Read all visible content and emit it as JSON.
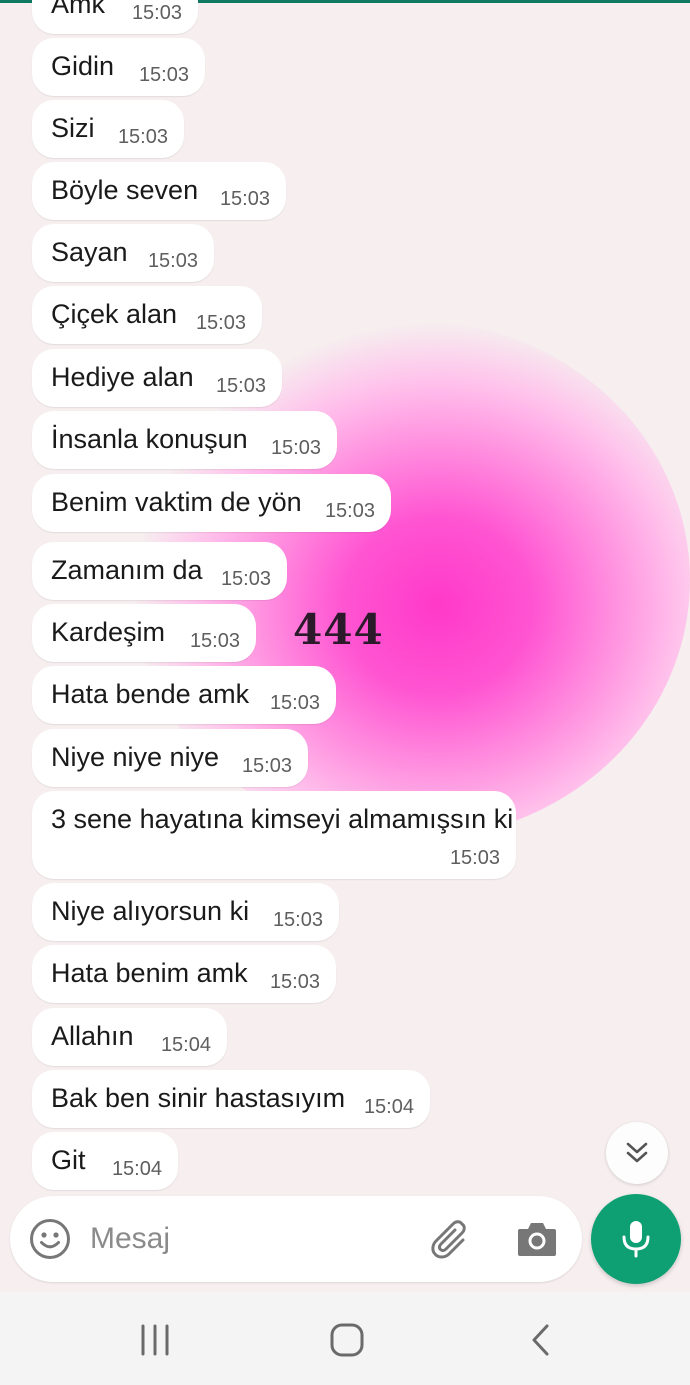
{
  "chat": {
    "messages": [
      {
        "text": "Amk",
        "time": "15:03"
      },
      {
        "text": "Gidin",
        "time": "15:03"
      },
      {
        "text": "Sizi",
        "time": "15:03"
      },
      {
        "text": "Böyle seven",
        "time": "15:03"
      },
      {
        "text": "Sayan",
        "time": "15:03"
      },
      {
        "text": "Çiçek alan",
        "time": "15:03"
      },
      {
        "text": "Hediye alan",
        "time": "15:03"
      },
      {
        "text": "İnsanla konuşun",
        "time": "15:03"
      },
      {
        "text": "Benim vaktim de yön",
        "time": "15:03"
      },
      {
        "text": "Zamanım da",
        "time": "15:03"
      },
      {
        "text": "Kardeşim",
        "time": "15:03"
      },
      {
        "text": "Hata bende amk",
        "time": "15:03"
      },
      {
        "text": "Niye niye niye",
        "time": "15:03"
      },
      {
        "text": "3 sene hayatına kimseyi almamışsın ki",
        "time": "15:03"
      },
      {
        "text": "Niye alıyorsun ki",
        "time": "15:03"
      },
      {
        "text": "Hata benim amk",
        "time": "15:03"
      },
      {
        "text": "Allahın",
        "time": "15:04"
      },
      {
        "text": "Bak ben sinir hastasıyım",
        "time": "15:04"
      },
      {
        "text": "Git",
        "time": "15:04"
      }
    ],
    "wallpaper_text": "444"
  },
  "composer": {
    "placeholder": "Mesaj",
    "emoji_icon": "emoji-icon",
    "attach_icon": "paperclip-icon",
    "camera_icon": "camera-icon",
    "mic_icon": "microphone-icon"
  },
  "scroll_button_icon": "double-chevron-down-icon",
  "nav": {
    "recents_icon": "recent-apps-icon",
    "home_icon": "home-icon",
    "back_icon": "back-icon"
  },
  "colors": {
    "accent": "#0e9f73",
    "bubble": "#ffffff",
    "background": "#f6eeef",
    "wallpaper_glow": "#ff39c9"
  }
}
